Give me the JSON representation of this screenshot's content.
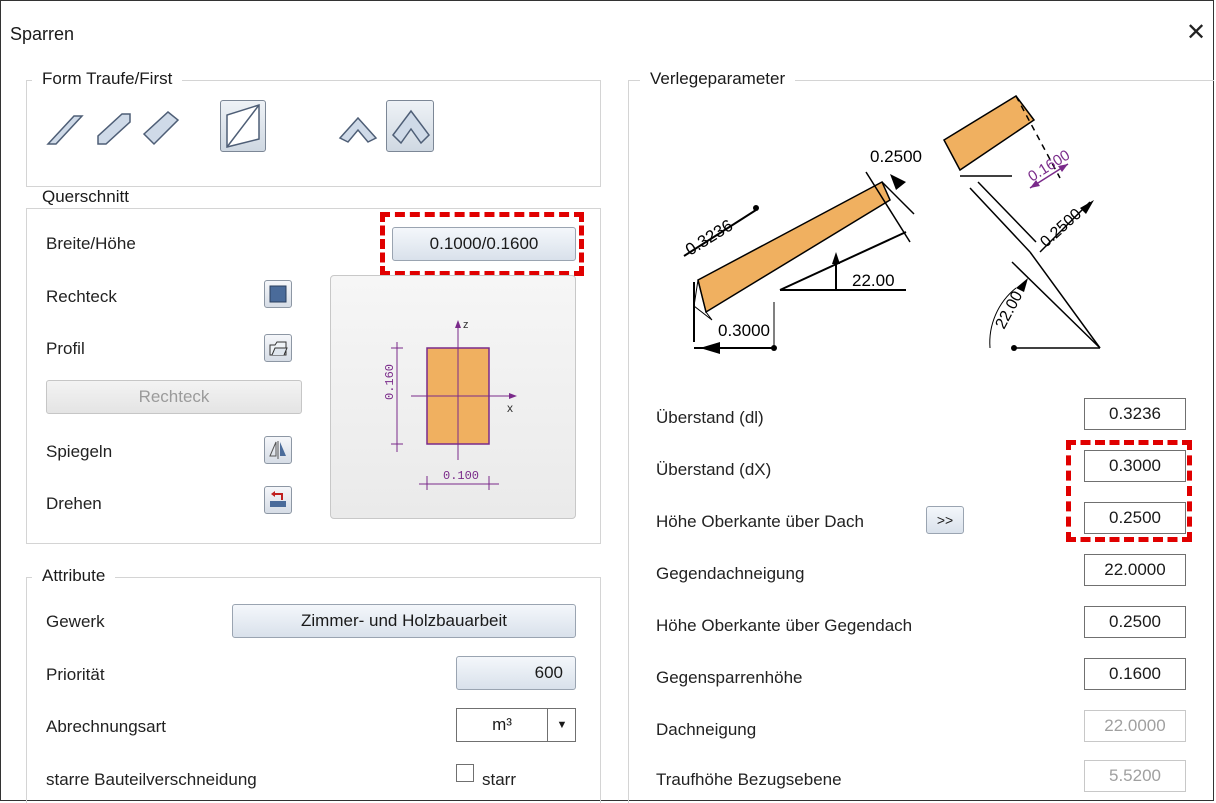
{
  "window": {
    "title": "Sparren"
  },
  "form": {
    "header": "Form Traufe/First"
  },
  "querschnitt": {
    "header": "Querschnitt",
    "breite_hoehe_label": "Breite/Höhe",
    "breite_hoehe_value": "0.1000/0.1600",
    "rechteck_label": "Rechteck",
    "profil_label": "Profil",
    "rechteck_button": "Rechteck",
    "spiegeln_label": "Spiegeln",
    "drehen_label": "Drehen",
    "preview": {
      "z_label": "z",
      "x_label": "x",
      "height_dim": "0.160",
      "width_dim": "0.100"
    }
  },
  "attribute": {
    "header": "Attribute",
    "gewerk_label": "Gewerk",
    "gewerk_value": "Zimmer- und Holzbauarbeit",
    "prioritaet_label": "Priorität",
    "prioritaet_value": "600",
    "abrechnung_label": "Abrechnungsart",
    "abrechnung_value": "m³",
    "starr_label": "starre Bauteilverschneidung",
    "starr_checkbox_label": "starr"
  },
  "verlege": {
    "header": "Verlegeparameter",
    "diagram": {
      "dim_dl": "0.3236",
      "dim_top": "0.2500",
      "dim_angle": "22.00",
      "dim_dx": "0.3000",
      "dim_gegen_hoehe": "0.1600",
      "dim_gegen_ok": "0.2500",
      "dim_gegen_angle": "22.00"
    },
    "rows": [
      {
        "label": "Überstand (dl)",
        "value": "0.3236"
      },
      {
        "label": "Überstand (dX)",
        "value": "0.3000"
      },
      {
        "label": "Höhe Oberkante über Dach",
        "value": "0.2500",
        "button": ">>"
      },
      {
        "label": "Gegendachneigung",
        "value": "22.0000"
      },
      {
        "label": "Höhe Oberkante über Gegendach",
        "value": "0.2500"
      },
      {
        "label": "Gegensparrenhöhe",
        "value": "0.1600"
      },
      {
        "label": "Dachneigung",
        "value": "22.0000"
      },
      {
        "label": "Traufhöhe Bezugsebene",
        "value": "5.5200"
      }
    ]
  },
  "colors": {
    "wood": "#f0b060",
    "dim_purple": "#7a2a8a",
    "highlight_red": "#e00000"
  }
}
